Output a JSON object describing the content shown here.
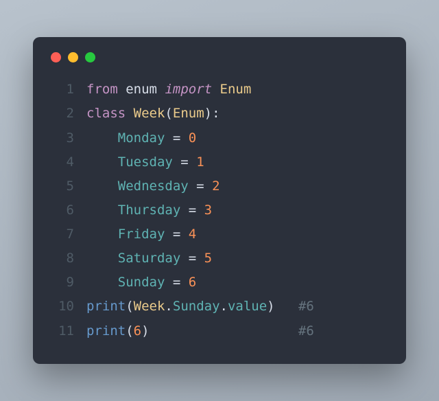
{
  "window": {
    "dots": [
      "red",
      "yellow",
      "green"
    ]
  },
  "code": {
    "lines": [
      {
        "n": "1",
        "tokens": [
          {
            "c": "kw",
            "t": "from"
          },
          {
            "c": "plain",
            "t": " "
          },
          {
            "c": "mod",
            "t": "enum"
          },
          {
            "c": "plain",
            "t": " "
          },
          {
            "c": "kw-it",
            "t": "import"
          },
          {
            "c": "plain",
            "t": " "
          },
          {
            "c": "cls",
            "t": "Enum"
          }
        ]
      },
      {
        "n": "2",
        "tokens": [
          {
            "c": "kw",
            "t": "class"
          },
          {
            "c": "plain",
            "t": " "
          },
          {
            "c": "cls",
            "t": "Week"
          },
          {
            "c": "pun",
            "t": "("
          },
          {
            "c": "cls",
            "t": "Enum"
          },
          {
            "c": "pun",
            "t": ")"
          },
          {
            "c": "pun",
            "t": ":"
          }
        ]
      },
      {
        "n": "3",
        "tokens": [
          {
            "c": "plain",
            "t": "    "
          },
          {
            "c": "attr",
            "t": "Monday"
          },
          {
            "c": "plain",
            "t": " "
          },
          {
            "c": "pun",
            "t": "="
          },
          {
            "c": "plain",
            "t": " "
          },
          {
            "c": "num",
            "t": "0"
          }
        ]
      },
      {
        "n": "4",
        "tokens": [
          {
            "c": "plain",
            "t": "    "
          },
          {
            "c": "attr",
            "t": "Tuesday"
          },
          {
            "c": "plain",
            "t": " "
          },
          {
            "c": "pun",
            "t": "="
          },
          {
            "c": "plain",
            "t": " "
          },
          {
            "c": "num",
            "t": "1"
          }
        ]
      },
      {
        "n": "5",
        "tokens": [
          {
            "c": "plain",
            "t": "    "
          },
          {
            "c": "attr",
            "t": "Wednesday"
          },
          {
            "c": "plain",
            "t": " "
          },
          {
            "c": "pun",
            "t": "="
          },
          {
            "c": "plain",
            "t": " "
          },
          {
            "c": "num",
            "t": "2"
          }
        ]
      },
      {
        "n": "6",
        "tokens": [
          {
            "c": "plain",
            "t": "    "
          },
          {
            "c": "attr",
            "t": "Thursday"
          },
          {
            "c": "plain",
            "t": " "
          },
          {
            "c": "pun",
            "t": "="
          },
          {
            "c": "plain",
            "t": " "
          },
          {
            "c": "num",
            "t": "3"
          }
        ]
      },
      {
        "n": "7",
        "tokens": [
          {
            "c": "plain",
            "t": "    "
          },
          {
            "c": "attr",
            "t": "Friday"
          },
          {
            "c": "plain",
            "t": " "
          },
          {
            "c": "pun",
            "t": "="
          },
          {
            "c": "plain",
            "t": " "
          },
          {
            "c": "num",
            "t": "4"
          }
        ]
      },
      {
        "n": "8",
        "tokens": [
          {
            "c": "plain",
            "t": "    "
          },
          {
            "c": "attr",
            "t": "Saturday"
          },
          {
            "c": "plain",
            "t": " "
          },
          {
            "c": "pun",
            "t": "="
          },
          {
            "c": "plain",
            "t": " "
          },
          {
            "c": "num",
            "t": "5"
          }
        ]
      },
      {
        "n": "9",
        "tokens": [
          {
            "c": "plain",
            "t": "    "
          },
          {
            "c": "attr",
            "t": "Sunday"
          },
          {
            "c": "plain",
            "t": " "
          },
          {
            "c": "pun",
            "t": "="
          },
          {
            "c": "plain",
            "t": " "
          },
          {
            "c": "num",
            "t": "6"
          }
        ]
      },
      {
        "n": "10",
        "tokens": [
          {
            "c": "fn",
            "t": "print"
          },
          {
            "c": "pun",
            "t": "("
          },
          {
            "c": "cls",
            "t": "Week"
          },
          {
            "c": "pun",
            "t": "."
          },
          {
            "c": "attr",
            "t": "Sunday"
          },
          {
            "c": "pun",
            "t": "."
          },
          {
            "c": "attr",
            "t": "value"
          },
          {
            "c": "pun",
            "t": ")"
          },
          {
            "c": "plain",
            "t": "   "
          },
          {
            "c": "cmt",
            "t": "#6"
          }
        ]
      },
      {
        "n": "11",
        "tokens": [
          {
            "c": "fn",
            "t": "print"
          },
          {
            "c": "pun",
            "t": "("
          },
          {
            "c": "num",
            "t": "6"
          },
          {
            "c": "pun",
            "t": ")"
          },
          {
            "c": "plain",
            "t": "                   "
          },
          {
            "c": "cmt",
            "t": "#6"
          }
        ]
      }
    ]
  }
}
